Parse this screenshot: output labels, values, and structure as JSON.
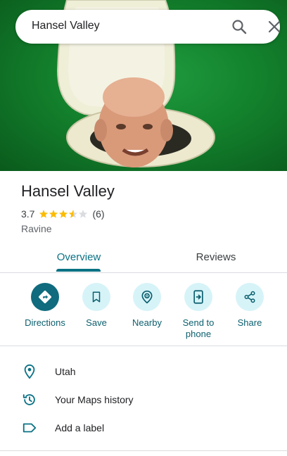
{
  "search": {
    "query": "Hansel Valley"
  },
  "place": {
    "title": "Hansel Valley",
    "rating": "3.7",
    "rating_fraction": 0.74,
    "review_count": "(6)",
    "category": "Ravine"
  },
  "tabs": [
    {
      "label": "Overview",
      "active": true
    },
    {
      "label": "Reviews",
      "active": false
    }
  ],
  "actions": [
    {
      "label": "Directions",
      "icon": "directions-icon"
    },
    {
      "label": "Save",
      "icon": "bookmark-icon"
    },
    {
      "label": "Nearby",
      "icon": "nearby-icon"
    },
    {
      "label": "Send to\nphone",
      "icon": "send-to-phone-icon"
    },
    {
      "label": "Share",
      "icon": "share-icon"
    }
  ],
  "details": [
    {
      "label": "Utah",
      "icon": "location-pin-icon"
    },
    {
      "label": "Your Maps history",
      "icon": "history-icon"
    },
    {
      "label": "Add a label",
      "icon": "label-icon"
    }
  ],
  "colors": {
    "accent": "#0b7285",
    "star_fill": "#fbbc04",
    "star_empty": "#dadce0",
    "action_bg": "#d6f3f8",
    "hero_green": "#13822d"
  }
}
